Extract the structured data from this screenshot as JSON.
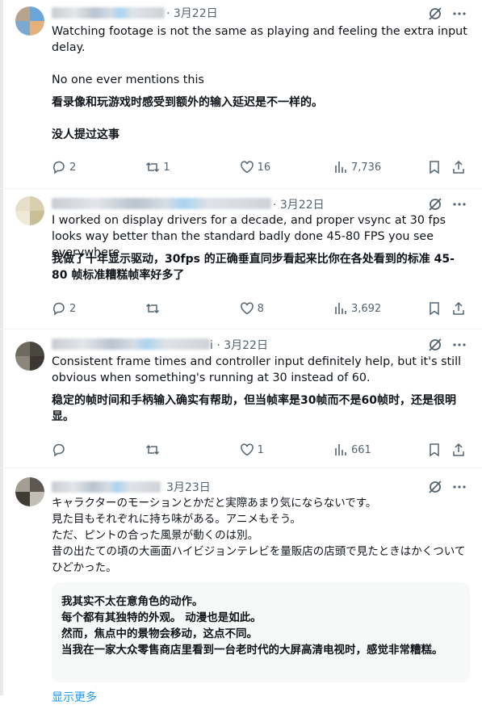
{
  "tweets": [
    {
      "date": "· 3月22日",
      "text": "Watching footage is not the same as playing and feeling the extra input delay.\n\nNo one ever mentions this",
      "translation": "看录像和玩游戏时感受到额外的输入延迟是不一样的。\n\n没人提过这事",
      "replies": "2",
      "retweets": "1",
      "likes": "16",
      "views": "7,736"
    },
    {
      "date": "· 3月22日",
      "text": "I worked on display drivers for a decade, and proper vsync at 30 fps looks way better than the standard badly done 45-80 FPS you see everywhere",
      "translation": "我做了十年显示驱动，30fps 的正确垂直同步看起来比你在各处看到的标准 45-80 帧标准糟糕帧率好多了",
      "replies": "2",
      "retweets": "",
      "likes": "8",
      "views": "3,692"
    },
    {
      "date": "i · 3月22日",
      "text": "Consistent frame times and controller input definitely help, but it's still obvious when something's running at 30 instead of 60.",
      "translation": "稳定的帧时间和手柄输入确实有帮助，但当帧率是30帧而不是60帧时，还是很明显。",
      "replies": "",
      "retweets": "",
      "likes": "1",
      "views": "661"
    },
    {
      "date": "3月23日",
      "text": "キャラクターのモーションとかだと実際あまり気にならないです。\n見た目もそれぞれに持ち味がある。アニメもそう。\nただ、ピントの合った風景が動くのは別。\n昔の出たての頃の大画面ハイビジョンテレビを量販店の店頭で見たときはかくついてひどかった。",
      "translation": "我其实不太在意角色的动作。\n每个都有其独特的外观。 动漫也是如此。\n然而，焦点中的景物会移动，这点不同。\n当我在一家大众零售商店里看到一台老时代的大屏高清电视时，感觉非常糟糕。",
      "show_more": "显示更多"
    }
  ]
}
